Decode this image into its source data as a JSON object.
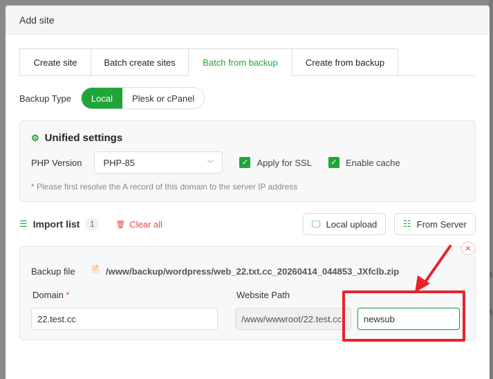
{
  "modal": {
    "title": "Add site"
  },
  "tabs": [
    {
      "label": "Create site",
      "active": false
    },
    {
      "label": "Batch create sites",
      "active": false
    },
    {
      "label": "Batch from backup",
      "active": true
    },
    {
      "label": "Create from backup",
      "active": false
    }
  ],
  "backup_type": {
    "label": "Backup Type",
    "options": [
      "Local",
      "Plesk or cPanel"
    ],
    "selected": "Local"
  },
  "unified": {
    "title": "Unified settings",
    "php_label": "PHP Version",
    "php_value": "PHP-85",
    "apply_ssl_label": "Apply for SSL",
    "apply_ssl_checked": true,
    "enable_cache_label": "Enable cache",
    "enable_cache_checked": true,
    "hint": "* Please first resolve the A record of this domain to the server IP address"
  },
  "import": {
    "title": "Import list",
    "count": "1",
    "clear_all": "Clear all",
    "local_upload": "Local upload",
    "from_server": "From Server"
  },
  "item": {
    "backup_file_label": "Backup file",
    "backup_file_path": "/www/backup/wordpress/web_22.txt.cc_20260414_044853_JXfclb.zip",
    "domain_label": "Domain",
    "domain_required_mark": "*",
    "domain_value": "22.test.cc",
    "website_path_label": "Website Path",
    "website_path_value": "/www/wwwroot/22.test.cc",
    "subdir_value": "newsub"
  },
  "colors": {
    "accent": "#20a53a",
    "danger": "#e64545",
    "annotation": "#e8232b"
  },
  "icons": [
    "gear-icon",
    "list-icon",
    "trash-icon",
    "monitor-icon",
    "server-icon",
    "file-icon",
    "close-icon",
    "chevron-down-icon",
    "check-icon"
  ]
}
